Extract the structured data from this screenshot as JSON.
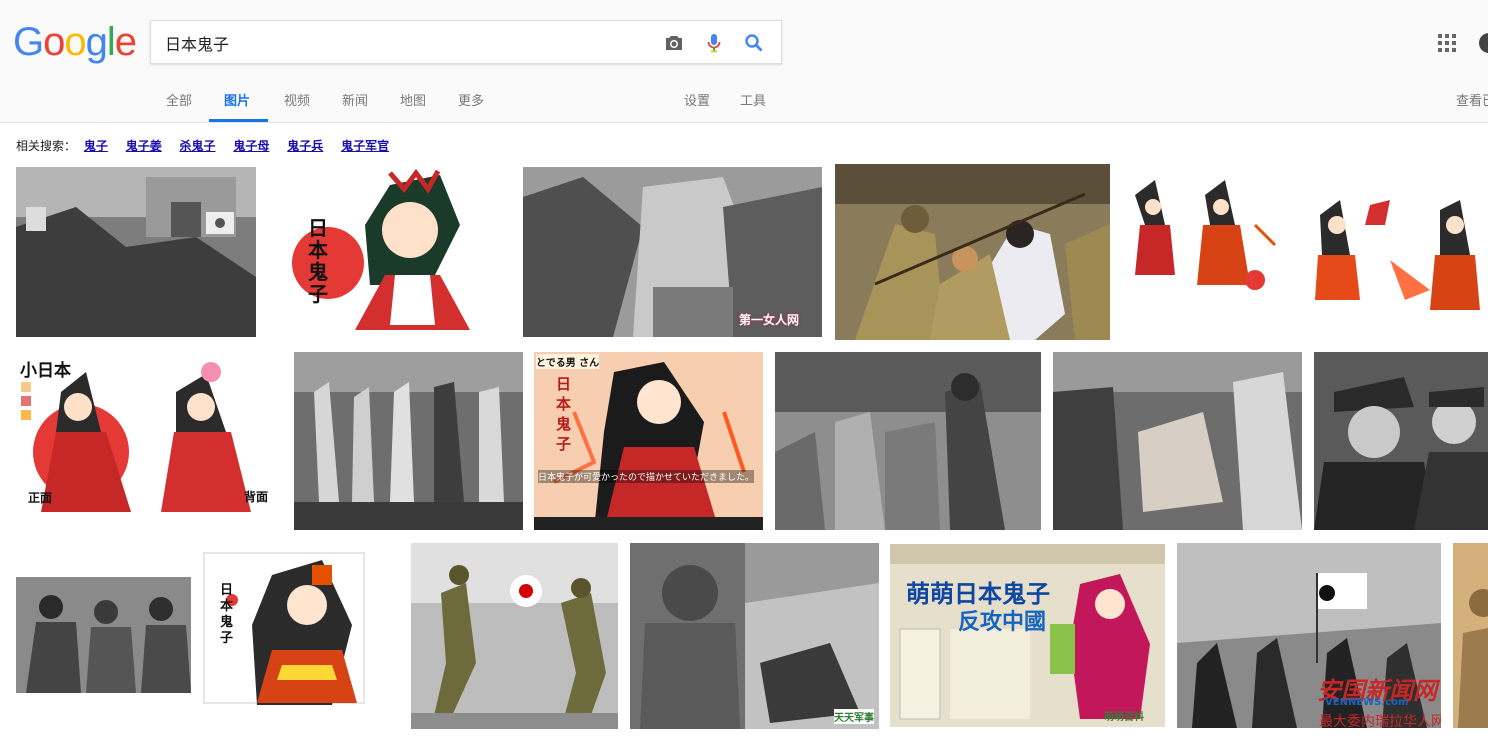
{
  "logo": {
    "letters": [
      "G",
      "o",
      "o",
      "g",
      "l",
      "e"
    ],
    "colors": [
      "#4285f4",
      "#ea4335",
      "#fbbc05",
      "#4285f4",
      "#34a853",
      "#ea4335"
    ]
  },
  "search": {
    "value": "日本鬼子"
  },
  "tabs": [
    "全部",
    "图片",
    "视频",
    "新闻",
    "地图",
    "更多",
    "设置",
    "工具"
  ],
  "active_tab": "图片",
  "view_history": "查看已",
  "related": {
    "label": "相关搜索：",
    "links": [
      "鬼子",
      "鬼子姜",
      "杀鬼子",
      "鬼子母",
      "鬼子兵",
      "鬼子军官"
    ]
  },
  "watermarks": {
    "img3": "第一女人网",
    "img21": "萌萌百科",
    "img22_title": "安国新闻网",
    "img22_sub": "VENNEWS.com",
    "img22_caption": "最大委内瑞拉华人网",
    "img20": "天天军事"
  },
  "image_labels": {
    "img2_text": "日本鬼子",
    "img7_title": "小日本",
    "img7_front": "正面",
    "img7_back": "背面",
    "img9_tag": "とでる男 さん",
    "img9_text": "日本鬼子",
    "img9_caption": "日本鬼子が可愛かったので描かせていただきました。",
    "img21_headline": "萌萌日本鬼子",
    "img21_sub": "反攻中國",
    "img17_text": "日本鬼子"
  },
  "accent": "#1a73e8",
  "link_color": "#1a0dab"
}
